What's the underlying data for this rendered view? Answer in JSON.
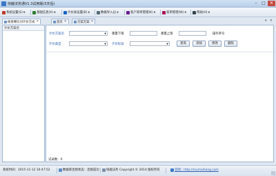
{
  "window": {
    "title": "快鹿法务通V1.3试用版(5天后)"
  },
  "menu": [
    {
      "label": "系统设置(S)",
      "icon": "gear-icon",
      "color": "#c0392b"
    },
    {
      "label": "基础信息(X)",
      "icon": "edit-icon",
      "color": "#2e7d32"
    },
    {
      "label": "计价表设置(B)",
      "icon": "table-icon",
      "color": "#1565c0"
    },
    {
      "label": "数据导入(J)",
      "icon": "import-icon",
      "color": "#546e7a"
    },
    {
      "label": "客户简单管理(K)",
      "icon": "customer-icon",
      "color": "#6a1b9a"
    },
    {
      "label": "案单管理(W)",
      "icon": "case-icon",
      "color": "#ad1457"
    },
    {
      "label": "帮助(H)",
      "icon": "help-icon",
      "color": "#37474f"
    }
  ],
  "tabs": [
    {
      "label": "核查要比对计价方式",
      "active": true
    },
    {
      "label": "首页",
      "active": false
    },
    {
      "label": "方案方案",
      "active": false
    }
  ],
  "left_panel": {
    "header": "计价方案名"
  },
  "form": {
    "plan_name_label": "计价方案名",
    "lower_limit_label": "重量下限",
    "upper_limit_label": "重量上限",
    "op_label": "操作单号",
    "type_label": "计价类型",
    "standard_label": "计价标准",
    "buttons": {
      "query": "查询",
      "add": "添加",
      "modify": "修改",
      "delete": "删除"
    },
    "record_count": "记录数：0"
  },
  "status": {
    "system_time": "系统时间：2015-11-12 16:47:52",
    "db_status": "数据库连接状态：连接成功",
    "copyright": "快鹿法务 Copyright © 2014 版权所有",
    "website": "官网：http://mumaihang.com"
  }
}
